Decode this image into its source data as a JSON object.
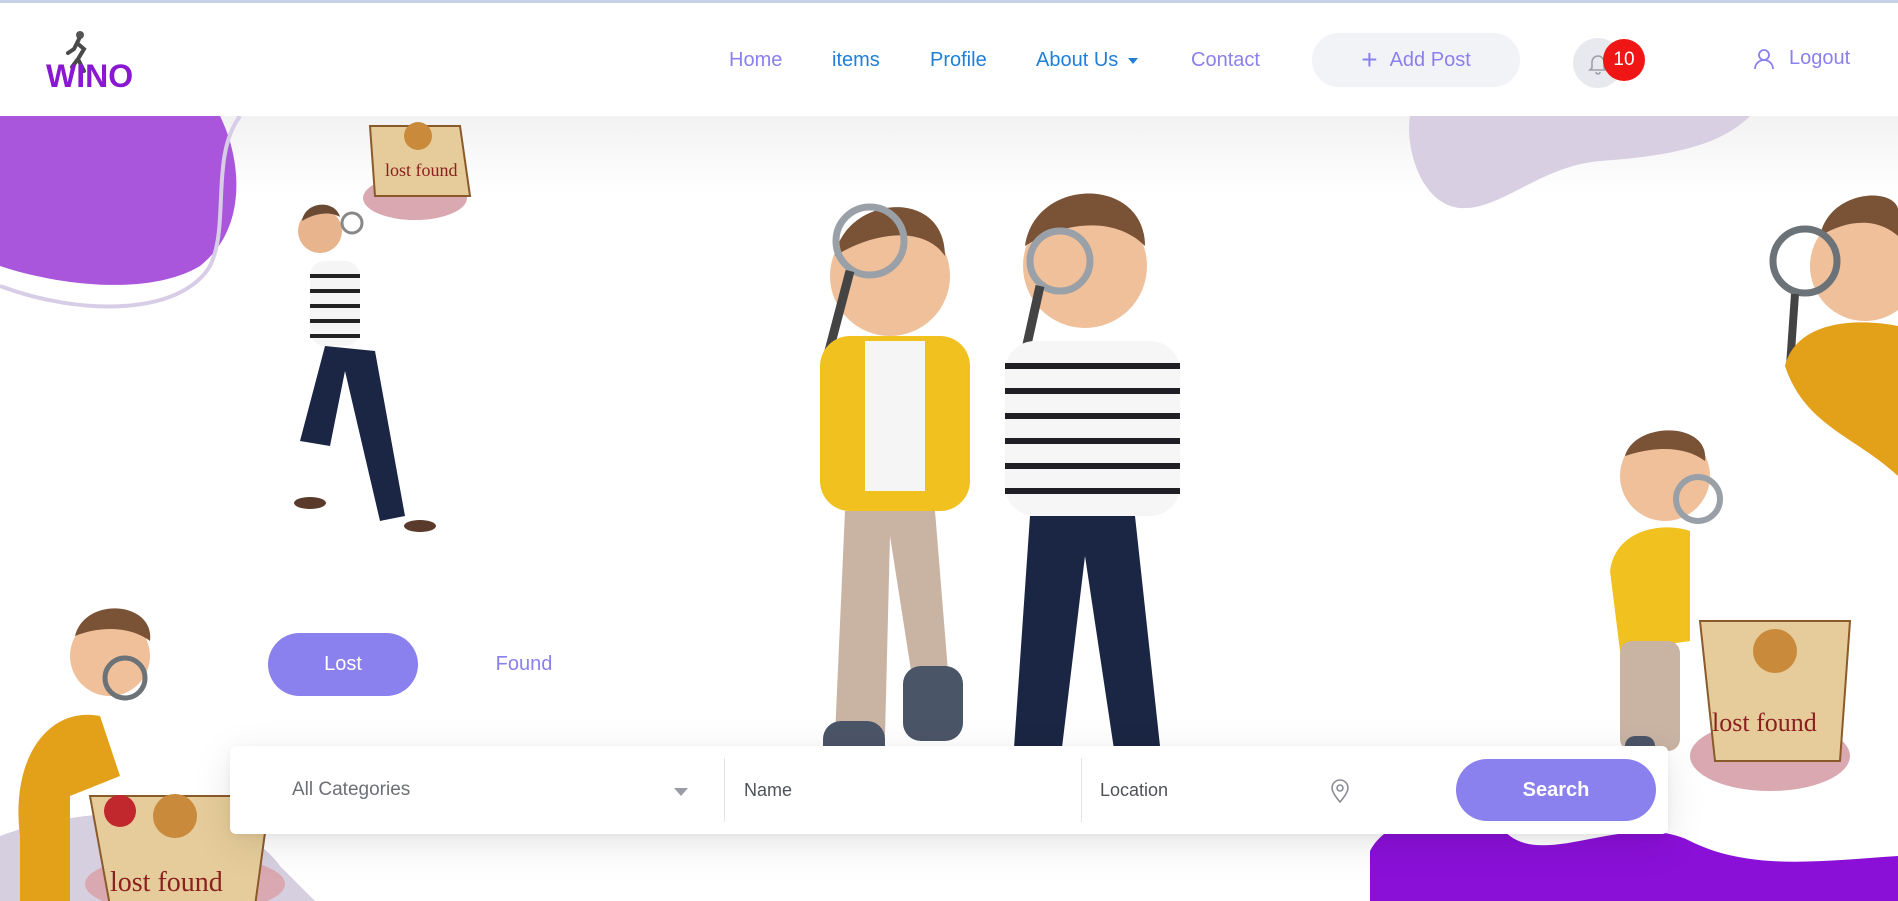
{
  "brand": {
    "logo_text": "WINO",
    "accent": "#8a80ee",
    "logo_purple": "#8a18d2"
  },
  "nav": {
    "items": [
      {
        "label": "Home"
      },
      {
        "label": "items"
      },
      {
        "label": "Profile"
      },
      {
        "label": "About Us"
      },
      {
        "label": "Contact"
      }
    ],
    "add_post_label": "Add Post",
    "notifications_count": "10",
    "logout_label": "Logout"
  },
  "icons": [
    "plus-icon",
    "bell-icon",
    "user-icon",
    "chevron-down-icon",
    "location-pin-icon"
  ],
  "hero": {
    "tabs": [
      {
        "label": "Lost",
        "active": true
      },
      {
        "label": "Found",
        "active": false
      }
    ],
    "box_label": "lost found"
  },
  "search": {
    "category_selected": "All Categories",
    "name_placeholder": "Name",
    "location_placeholder": "Location",
    "button_label": "Search"
  }
}
